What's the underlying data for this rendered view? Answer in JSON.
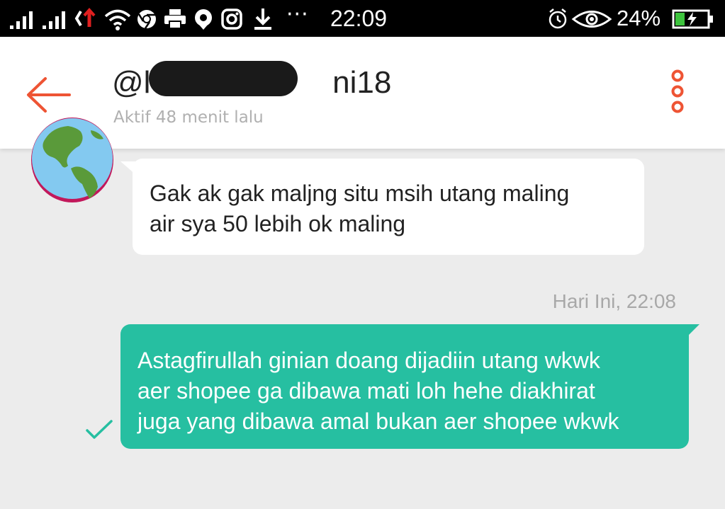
{
  "status_bar": {
    "more_indicator": "···",
    "time": "22:09",
    "battery_percent": "24%",
    "icons": [
      "signal-icon",
      "signal-icon",
      "network-icon",
      "wifi-icon",
      "chrome-icon",
      "printer-icon",
      "location-icon",
      "instagram-icon",
      "download-icon",
      "alarm-icon",
      "eye-icon",
      "battery-charging-icon"
    ]
  },
  "header": {
    "contact_name": "@l                     ni18",
    "status": "Aktif 48 menit lalu",
    "back_icon": "back-arrow-icon",
    "menu_icon": "more-vertical-icon",
    "accent_color": "#ee5434"
  },
  "messages": [
    {
      "direction": "incoming",
      "text": "Gak ak gak maljng situ msih utang maling\nair sya 50 lebih ok maling"
    },
    {
      "direction": "outgoing",
      "timestamp": "Hari Ini, 22:08",
      "text": "Astagfirullah ginian doang dijadiin utang wkwk\naer shopee ga dibawa mati loh hehe diakhirat\njuga yang dibawa amal bukan aer shopee wkwk",
      "status_icon": "check-icon",
      "bubble_color": "#26bfa1"
    }
  ]
}
